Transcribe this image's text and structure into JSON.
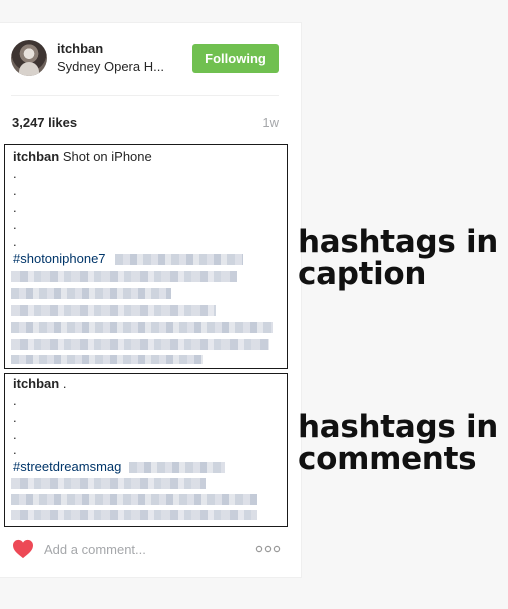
{
  "post": {
    "username": "itchban",
    "location": "Sydney Opera H...",
    "follow_label": "Following",
    "likes": "3,247 likes",
    "time_ago": "1w"
  },
  "caption": {
    "author": "itchban",
    "text": " Shot on iPhone",
    "dots": [
      ".",
      ".",
      ".",
      ".",
      "."
    ],
    "hashtag": "#shotoniphone7"
  },
  "comment": {
    "author": "itchban",
    "text": " .",
    "dots": [
      ".",
      ".",
      ".",
      "."
    ],
    "hashtag": "#streetdreamsmag"
  },
  "footer": {
    "comment_placeholder": "Add a comment...",
    "like_icon": "heart-icon",
    "more_icon": "more-options-icon"
  },
  "annotations": {
    "caption_line1": "hashtags in",
    "caption_line2": "caption",
    "comments_line1": "hashtags in",
    "comments_line2": "comments"
  },
  "colors": {
    "follow_button": "#70c050",
    "heart": "#ed4956",
    "hashtag": "#003569"
  }
}
